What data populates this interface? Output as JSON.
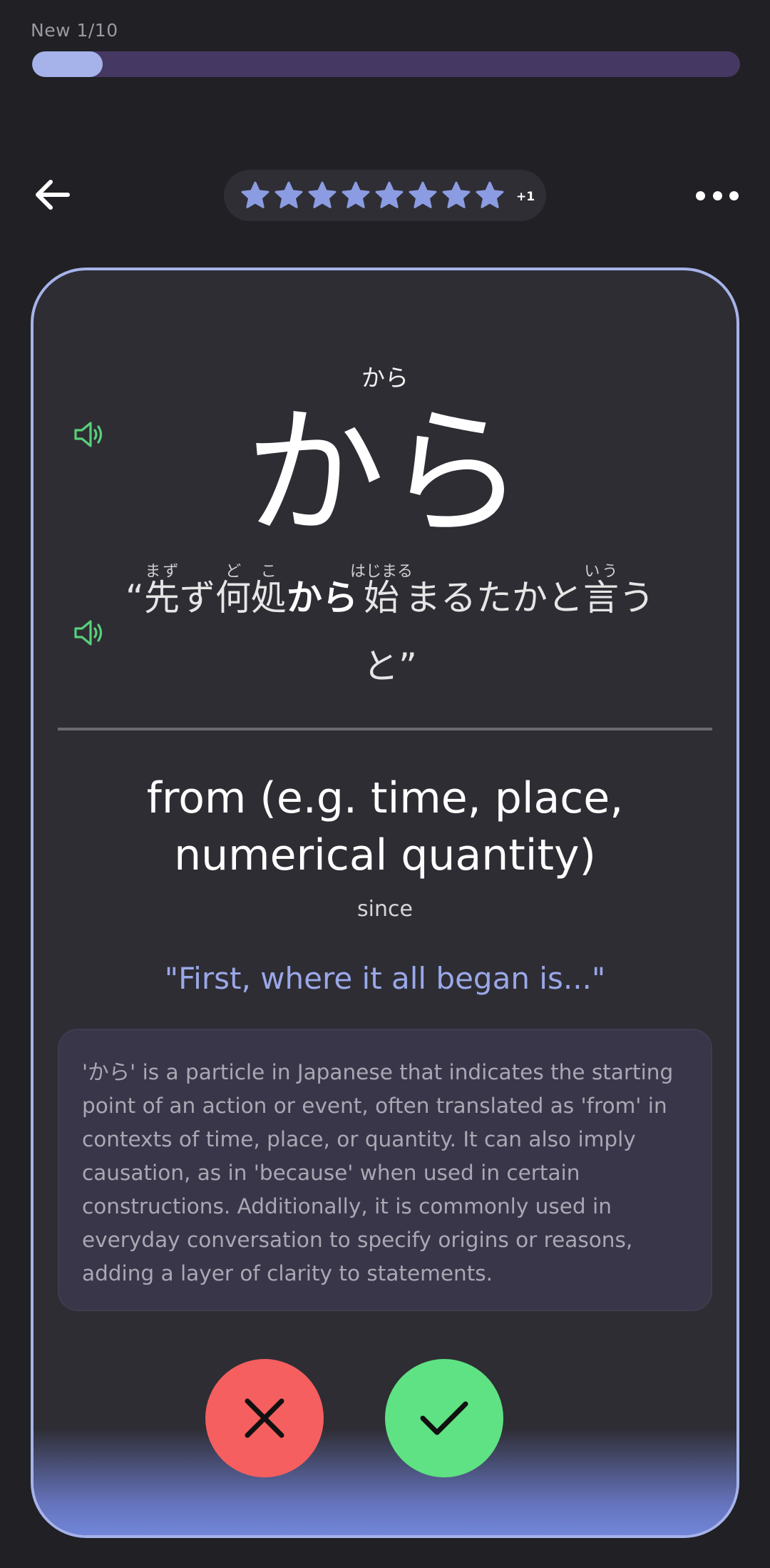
{
  "progress": {
    "label": "New 1/10",
    "fraction": 0.1
  },
  "header": {
    "back_icon": "arrow-left-icon",
    "stars": {
      "count": 8,
      "extra": "+1",
      "color": "#8c9ce2",
      "icon": "star-icon"
    },
    "more_icon": "more-horizontal-icon"
  },
  "card": {
    "reading": "から",
    "word": "から",
    "word_audio_icon": "speaker-icon",
    "sentence_audio_icon": "speaker-icon",
    "sentence": {
      "open_quote": "“",
      "segments": [
        {
          "base": "先",
          "ruby": "まず"
        },
        {
          "text": "ず"
        },
        {
          "base": "何処",
          "ruby": "どこ"
        },
        {
          "text": "から",
          "highlight": true
        },
        {
          "base": "始",
          "ruby": "はじまる"
        },
        {
          "text": "まるたかと"
        },
        {
          "base": "言",
          "ruby": "いう"
        },
        {
          "text": "うと"
        }
      ],
      "close_quote": "”"
    },
    "meaning": "from (e.g. time, place, numerical quantity)",
    "alternate": "since",
    "translation": "\"First, where it all began is...\"",
    "explanation": "'から' is a particle in Japanese that indicates the starting point of an action or event, often translated as 'from' in contexts of time, place, or quantity. It can also imply causation, as in 'because' when used in certain constructions. Additionally, it is commonly used in everyday conversation to specify origins or reasons, adding a layer of clarity to statements."
  },
  "actions": {
    "wrong_icon": "close-icon",
    "right_icon": "check-icon",
    "wrong_color": "#f65f5f",
    "right_color": "#5fe283"
  }
}
